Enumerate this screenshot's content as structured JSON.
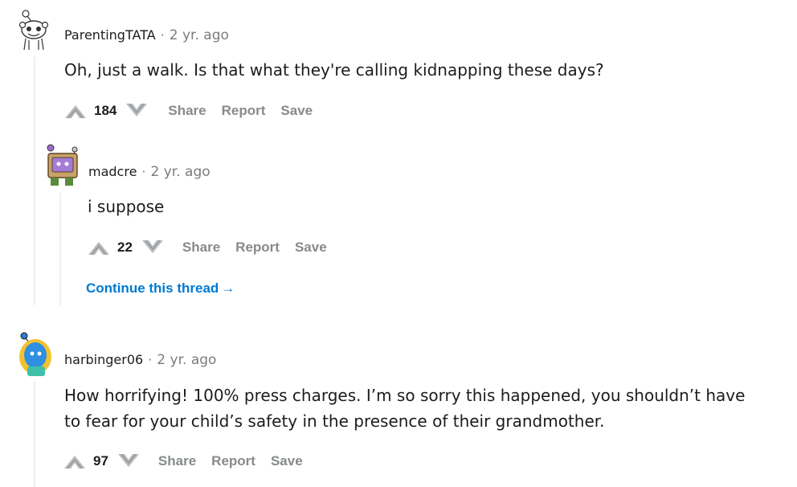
{
  "comments": [
    {
      "author": "ParentingTATA",
      "separator": "·",
      "time": "2 yr. ago",
      "text": "Oh, just a walk. Is that what they're calling kidnapping these days?",
      "score": "184",
      "actions": {
        "share": "Share",
        "report": "Report",
        "save": "Save"
      }
    },
    {
      "author": "madcre",
      "separator": "·",
      "time": "2 yr. ago",
      "text": "i suppose",
      "score": "22",
      "actions": {
        "share": "Share",
        "report": "Report",
        "save": "Save"
      },
      "continue_label": "Continue this thread",
      "continue_arrow": "→"
    },
    {
      "author": "harbinger06",
      "separator": "·",
      "time": "2 yr. ago",
      "text_line1": "How horrifying! 100% press charges. I’m so sorry this happened, you shouldn’t have",
      "text_line2": "to fear for your child’s safety in the presence of their grandmother.",
      "score": "97",
      "actions": {
        "share": "Share",
        "report": "Report",
        "save": "Save"
      }
    }
  ],
  "colors": {
    "text": "#1c1c1c",
    "meta": "#7c7c7c",
    "action": "#878a8c",
    "link": "#0079d3",
    "thread_line": "#edeff1"
  }
}
